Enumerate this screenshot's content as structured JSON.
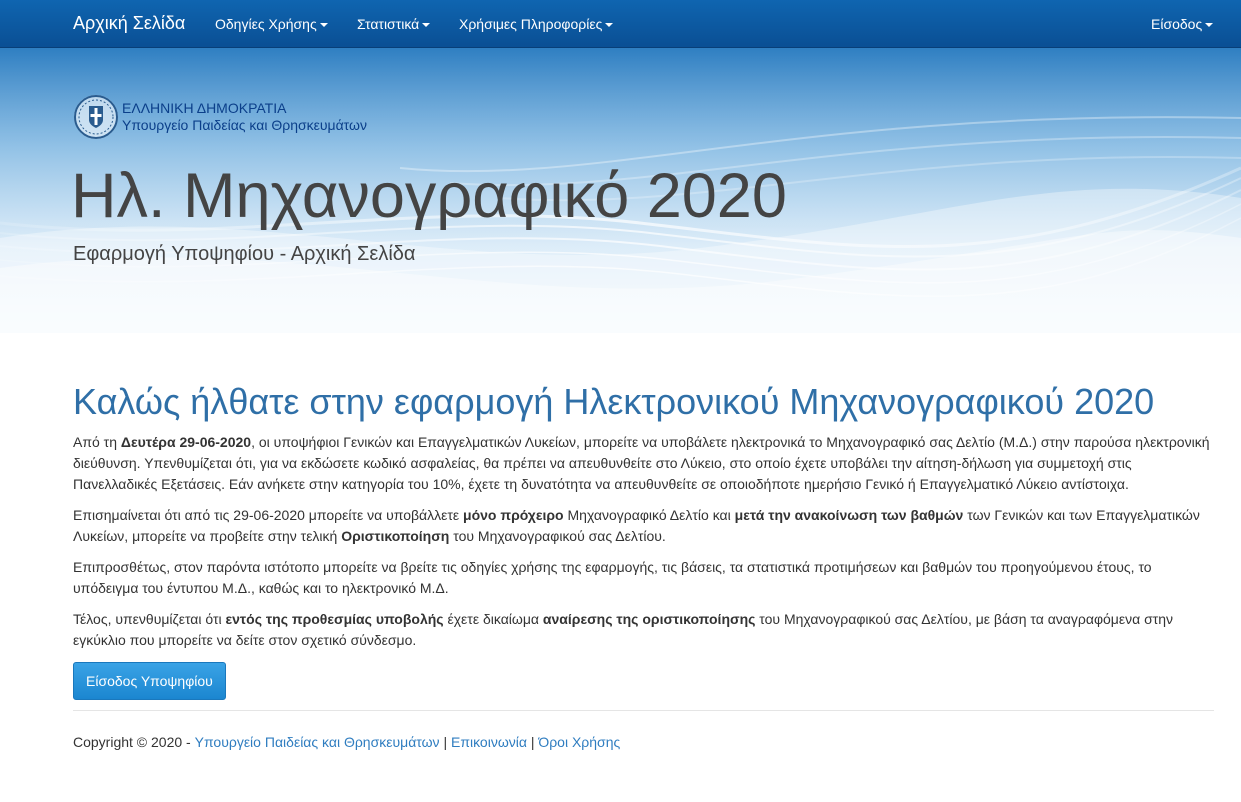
{
  "navbar": {
    "brand": "Αρχική Σελίδα",
    "items": [
      {
        "label": "Οδηγίες Χρήσης"
      },
      {
        "label": "Στατιστικά"
      },
      {
        "label": "Χρήσιμες Πληροφορίες"
      }
    ],
    "login": "Είσοδος"
  },
  "hero": {
    "gov_line1": "ΕΛΛΗΝΙΚΗ ΔΗΜΟΚΡΑΤΙΑ",
    "gov_line2": "Υπουργείο Παιδείας και Θρησκευμάτων",
    "title": "Ηλ. Μηχανογραφικό 2020",
    "subtitle": "Εφαρμογή Υποψηφίου - Αρχική Σελίδα"
  },
  "main": {
    "heading": "Καλώς ήλθατε στην εφαρμογή Ηλεκτρονικού Μηχανογραφικού 2020",
    "p1": {
      "a": "Από τη ",
      "b": "Δευτέρα 29-06-2020",
      "c": ", οι υποψήφιοι Γενικών και Επαγγελματικών Λυκείων, μπορείτε να υποβάλετε ηλεκτρονικά το Μηχανογραφικό σας Δελτίο (Μ.Δ.) στην παρούσα ηλεκτρονική διεύθυνση. Υπενθυμίζεται ότι, για να εκδώσετε κωδικό ασφαλείας, θα πρέπει να απευθυνθείτε στο Λύκειο, στο οποίο έχετε υποβάλει την αίτηση-δήλωση για συμμετοχή στις Πανελλαδικές Εξετάσεις. Εάν ανήκετε στην κατηγορία του 10%, έχετε τη δυνατότητα να απευθυνθείτε σε οποιοδήποτε ημερήσιο Γενικό ή Επαγγελματικό Λύκειο αντίστοιχα."
    },
    "p2": {
      "a": "Επισημαίνεται ότι από τις 29-06-2020 μπορείτε να υποβάλλετε ",
      "b": "μόνο πρόχειρο",
      "c": " Μηχανογραφικό Δελτίο και ",
      "d": "μετά την ανακοίνωση των βαθμών",
      "e": " των Γενικών και των Επαγγελματικών Λυκείων, μπορείτε να προβείτε στην τελική ",
      "f": "Οριστικοποίηση",
      "g": " του Μηχανογραφικού σας Δελτίου."
    },
    "p3": "Επιπροσθέτως, στον παρόντα ιστότοπο μπορείτε να βρείτε τις οδηγίες χρήσης της εφαρμογής, τις βάσεις, τα στατιστικά προτιμήσεων και βαθμών του προηγούμενου έτους, το υπόδειγμα του έντυπου Μ.Δ., καθώς και το ηλεκτρονικό Μ.Δ.",
    "p4": {
      "a": "Τέλος, υπενθυμίζεται ότι ",
      "b": "εντός της προθεσμίας υποβολής",
      "c": " έχετε δικαίωμα ",
      "d": "αναίρεσης της οριστικοποίησης",
      "e": " του Μηχανογραφικού σας Δελτίου, με βάση τα αναγραφόμενα στην εγκύκλιο που μπορείτε να δείτε στον σχετικό σύνδεσμο."
    },
    "button": "Είσοδος Υποψηφίου"
  },
  "footer": {
    "copyright": "Copyright © 2020 - ",
    "link_ministry": "Υπουργείο Παιδείας και Θρησκευμάτων",
    "sep1": " | ",
    "link_contact": "Επικοινωνία",
    "sep2": " | ",
    "link_terms": "Όροι Χρήσης"
  },
  "colors": {
    "navbar": "#0a4f94",
    "heading": "#2f6fa7",
    "link": "#2f7dc0",
    "button": "#1b86d0"
  }
}
